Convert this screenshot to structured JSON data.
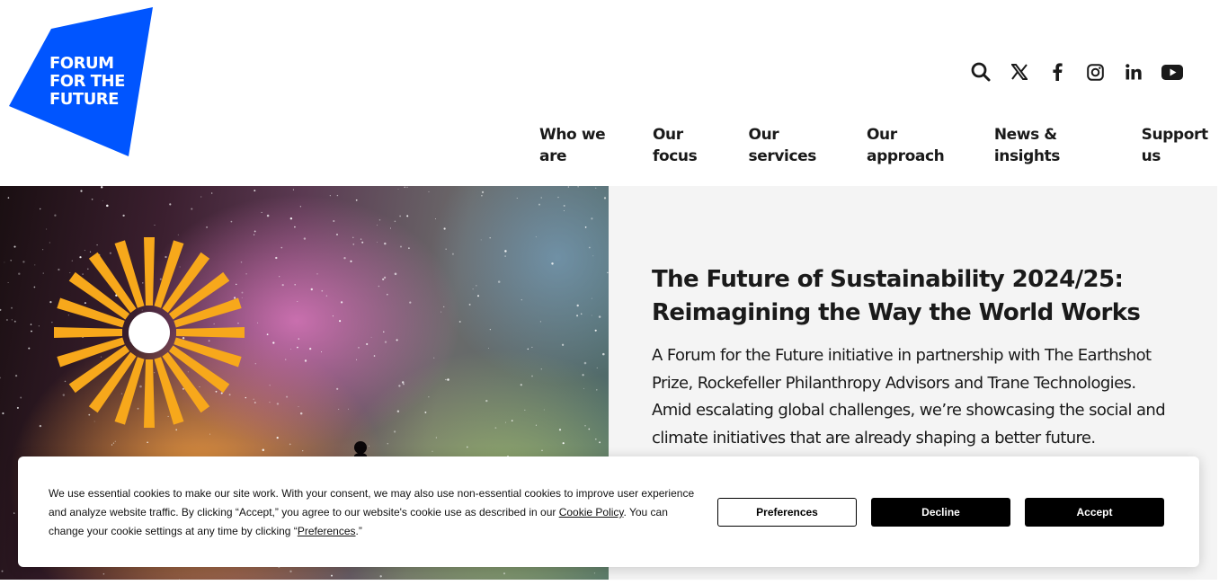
{
  "header": {
    "logo_lines": [
      "FORUM",
      "FOR THE",
      "FUTURE"
    ],
    "brand_color": "#0055FF",
    "icons": [
      "search-icon",
      "x-twitter-icon",
      "facebook-icon",
      "instagram-icon",
      "linkedin-icon",
      "youtube-icon"
    ]
  },
  "nav": {
    "items": [
      "Who we are",
      "Our focus",
      "Our services",
      "Our approach",
      "News & insights",
      "Support us"
    ]
  },
  "hero": {
    "title_line1": "The Future of Sustainability 2024/25:",
    "title_line2": "Reimagining the Way the World Works",
    "description": "A Forum for the Future initiative in partnership with The Earthshot Prize, Rockefeller Philanthropy Advisors and Trane Technologies.  Amid escalating global challenges, we’re showcasing the social and climate initiatives that are already shaping a better future.",
    "sun_color": "#F7A81B",
    "panel_color": "#F4F4F4"
  },
  "cookie": {
    "text_part1": "We use essential cookies to make our site work. With your consent, we may also use non-essential cookies to improve user experience and analyze website traffic. By clicking “Accept,” you agree to our website's cookie use as described in our ",
    "cookie_policy_link": "Cookie Policy",
    "text_part2": ". You can change your cookie settings at any time by clicking “",
    "preferences_link": "Preferences",
    "text_part3": ".”",
    "preferences_button": "Preferences",
    "decline_button": "Decline",
    "accept_button": "Accept"
  }
}
